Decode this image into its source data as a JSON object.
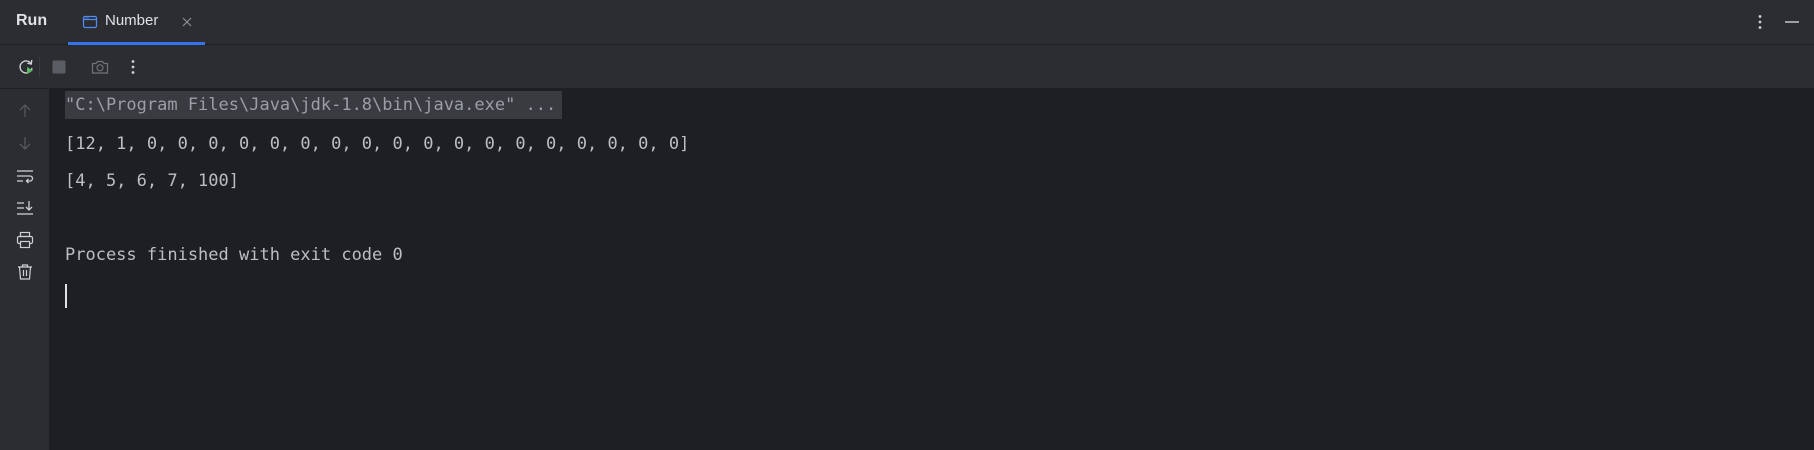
{
  "header": {
    "run_label": "Run",
    "tab": {
      "label": "Number",
      "icon": "window-icon"
    }
  },
  "toolbar": {
    "buttons": [
      "rerun-icon",
      "stop-icon",
      "camera-icon",
      "more-vertical-icon"
    ]
  },
  "gutter": {
    "buttons": [
      "arrow-up-icon",
      "arrow-down-icon",
      "soft-wrap-icon",
      "scroll-to-end-icon",
      "print-icon",
      "trash-icon"
    ]
  },
  "console": {
    "lines": [
      "\"C:\\Program Files\\Java\\jdk-1.8\\bin\\java.exe\" ...",
      "[12, 1, 0, 0, 0, 0, 0, 0, 0, 0, 0, 0, 0, 0, 0, 0, 0, 0, 0, 0]",
      "[4, 5, 6, 7, 100]",
      "",
      "Process finished with exit code 0"
    ]
  },
  "colors": {
    "accent": "#3574f0",
    "panel_bg": "#2b2d30",
    "console_bg": "#1e1f22",
    "text": "#bcbec4",
    "rerun_green": "#5fb865"
  }
}
